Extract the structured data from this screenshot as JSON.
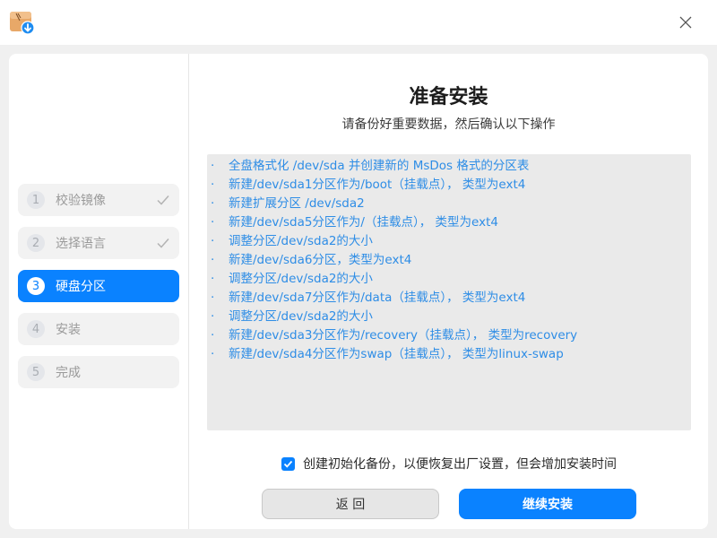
{
  "titlebar": {
    "app_icon": "package-download-icon",
    "close_icon": "close-icon"
  },
  "steps": [
    {
      "number": "1",
      "label": "校验镜像",
      "state": "done"
    },
    {
      "number": "2",
      "label": "选择语言",
      "state": "done"
    },
    {
      "number": "3",
      "label": "硬盘分区",
      "state": "active"
    },
    {
      "number": "4",
      "label": "安装",
      "state": "pending"
    },
    {
      "number": "5",
      "label": "完成",
      "state": "pending"
    }
  ],
  "main": {
    "title": "准备安装",
    "subtitle": "请备份好重要数据，然后确认以下操作",
    "bullet": "·",
    "operations": [
      "全盘格式化 /dev/sda 并创建新的 MsDos 格式的分区表",
      "新建/dev/sda1分区作为/boot（挂载点）， 类型为ext4",
      "新建扩展分区 /dev/sda2",
      "新建/dev/sda5分区作为/（挂载点）， 类型为ext4",
      "调整分区/dev/sda2的大小",
      "新建/dev/sda6分区，类型为ext4",
      "调整分区/dev/sda2的大小",
      "新建/dev/sda7分区作为/data（挂载点）， 类型为ext4",
      "调整分区/dev/sda2的大小",
      "新建/dev/sda3分区作为/recovery（挂载点）， 类型为recovery",
      "新建/dev/sda4分区作为swap（挂载点）， 类型为linux-swap"
    ],
    "backup_checkbox": {
      "checked": true,
      "label": "创建初始化备份，以便恢复出厂设置，但会增加安装时间"
    },
    "back_button": "返 回",
    "next_button": "继续安装"
  },
  "colors": {
    "accent": "#0a82ff",
    "operation_text": "#2e8de6",
    "done_check": "#b3b3b3"
  }
}
